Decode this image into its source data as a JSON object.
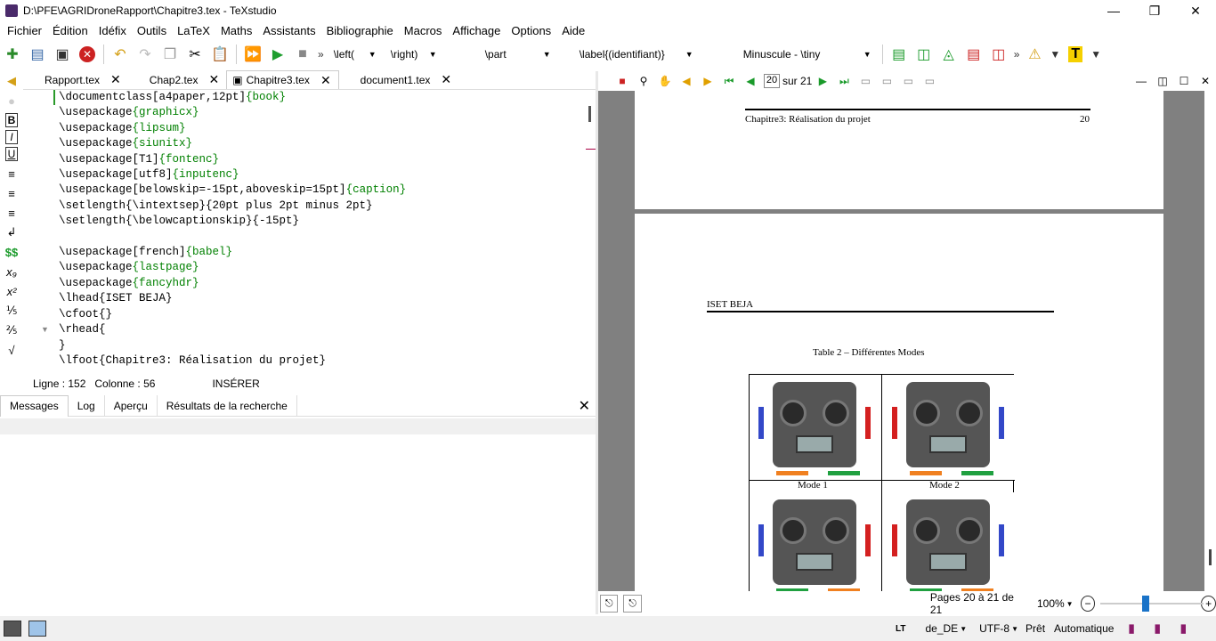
{
  "window": {
    "title": "D:\\PFE\\AGRIDroneRapport\\Chapitre3.tex - TeXstudio"
  },
  "menu": [
    "Fichier",
    "Édition",
    "Idéfix",
    "Outils",
    "LaTeX",
    "Maths",
    "Assistants",
    "Bibliographie",
    "Macros",
    "Affichage",
    "Options",
    "Aide"
  ],
  "toolbar": {
    "left_combo": "\\left(",
    "right_combo": "\\right)",
    "part_combo": "\\part",
    "label_combo": "\\label{(identifiant)}",
    "size_combo": "Minuscule - \\tiny"
  },
  "tabs": [
    {
      "label": "Rapport.tex"
    },
    {
      "label": "Chap2.tex"
    },
    {
      "label": "Chapitre3.tex"
    },
    {
      "label": "document1.tex"
    }
  ],
  "code_lines": [
    [
      "\\documentclass[a4paper,12pt]",
      "{book}"
    ],
    [
      "\\usepackage",
      "{graphicx}"
    ],
    [
      "\\usepackage",
      "{lipsum}"
    ],
    [
      "\\usepackage",
      "{siunitx}"
    ],
    [
      "\\usepackage[T1]",
      "{fontenc}"
    ],
    [
      "\\usepackage[utf8]",
      "{inputenc}"
    ],
    [
      "\\usepackage[belowskip=-15pt,aboveskip=15pt]",
      "{caption}"
    ],
    [
      "\\setlength{\\intextsep}{20pt plus 2pt minus 2pt}",
      ""
    ],
    [
      "\\setlength{\\belowcaptionskip}{-15pt}",
      ""
    ],
    [
      "",
      ""
    ],
    [
      "\\usepackage[french]",
      "{babel}"
    ],
    [
      "\\usepackage",
      "{lastpage}"
    ],
    [
      "\\usepackage",
      "{fancyhdr}"
    ],
    [
      "\\lhead{ISET BEJA}",
      ""
    ],
    [
      "\\cfoot{}",
      ""
    ],
    [
      "\\rhead{",
      ""
    ],
    [
      "}",
      ""
    ],
    [
      "\\lfoot{Chapitre3: Réalisation du projet}",
      ""
    ]
  ],
  "status": {
    "line": "Ligne : 152",
    "column": "Colonne : 56",
    "mode": "INSÉRER"
  },
  "lower_tabs": [
    "Messages",
    "Log",
    "Aperçu",
    "Résultats de la recherche"
  ],
  "pdf": {
    "page_current": "20",
    "page_total": "sur 21",
    "footer_chapter": "Chapitre3: Réalisation du projet",
    "footer_page": "20",
    "header_left": "ISET BEJA",
    "table_caption": "Table 2 – Différentes Modes",
    "mode1": "Mode 1",
    "mode2": "Mode 2",
    "pages_status": "Pages 20 à 21 de 21",
    "zoom": "100%"
  },
  "bottom": {
    "lang": "de_DE",
    "encoding": "UTF-8",
    "ready": "Prêt",
    "auto": "Automatique"
  }
}
